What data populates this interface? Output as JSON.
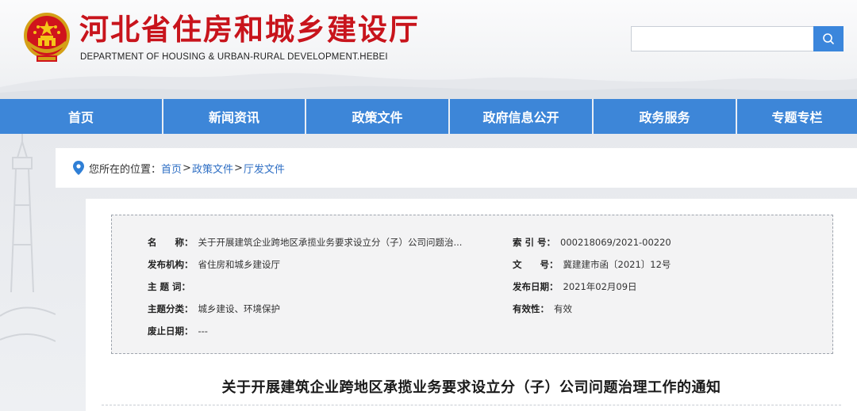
{
  "site": {
    "title": "河北省住房和城乡建设厅",
    "subtitle": "DEPARTMENT OF HOUSING & URBAN-RURAL DEVELOPMENT.HEBEI"
  },
  "search": {
    "placeholder": "",
    "value": ""
  },
  "nav": {
    "items": [
      {
        "label": "首页"
      },
      {
        "label": "新闻资讯"
      },
      {
        "label": "政策文件"
      },
      {
        "label": "政府信息公开"
      },
      {
        "label": "政务服务"
      },
      {
        "label": "专题专栏"
      }
    ]
  },
  "breadcrumb": {
    "prefix": "您所在的位置：",
    "items": [
      "首页",
      "政策文件",
      "厅发文件"
    ],
    "separator": ">"
  },
  "meta": {
    "name_label": "名　　称：",
    "name_value": "关于开展建筑企业跨地区承揽业务要求设立分（子）公司问题治...",
    "index_label": "索 引 号：",
    "index_value": "000218069/2021-00220",
    "issuer_label": "发布机构：",
    "issuer_value": "省住房和城乡建设厅",
    "docno_label": "文　　号：",
    "docno_value": "冀建建市函〔2021〕12号",
    "keywords_label": "主 题 词：",
    "keywords_value": "",
    "date_label": "发布日期：",
    "date_value": "2021年02月09日",
    "category_label": "主题分类：",
    "category_value": "城乡建设、环境保护",
    "validity_label": "有效性：",
    "validity_value": "有效",
    "repeal_label": "废止日期：",
    "repeal_value": "---"
  },
  "article": {
    "title": "关于开展建筑企业跨地区承揽业务要求设立分（子）公司问题治理工作的通知"
  },
  "colors": {
    "brand_red": "#c8141c",
    "nav_blue": "#3d86d8",
    "link_blue": "#2f6fc4"
  },
  "icons": {
    "search": "search-icon",
    "location": "location-pin-icon",
    "emblem": "national-emblem-icon"
  }
}
